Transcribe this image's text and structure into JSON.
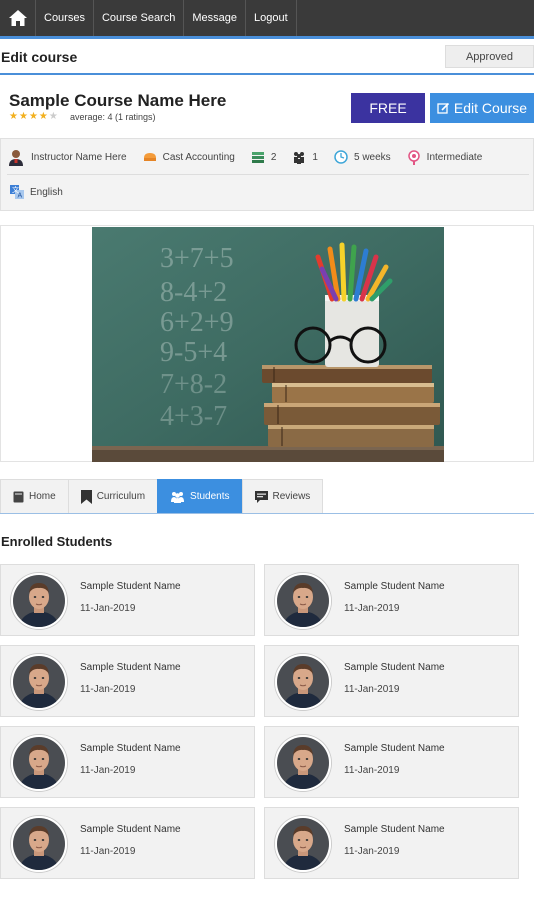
{
  "nav": {
    "items": [
      "Courses",
      "Course Search",
      "Message",
      "Logout"
    ]
  },
  "header": {
    "title": "Edit course",
    "status": "Approved"
  },
  "course": {
    "name": "Sample Course Name Here",
    "rating": 4,
    "rating_text": "average: 4 (1 ratings)",
    "price_label": "FREE",
    "edit_label": "Edit Course",
    "instructor": "Instructor Name Here",
    "category": "Cast Accounting",
    "lessons": "2",
    "students": "1",
    "duration": "5 weeks",
    "level": "Intermediate",
    "language": "English"
  },
  "tabs": [
    {
      "label": "Home"
    },
    {
      "label": "Curriculum"
    },
    {
      "label": "Students",
      "active": true
    },
    {
      "label": "Reviews"
    }
  ],
  "enrolled": {
    "title": "Enrolled Students",
    "students": [
      {
        "name": "Sample Student Name",
        "date": "11-Jan-2019"
      },
      {
        "name": "Sample Student Name",
        "date": "11-Jan-2019"
      },
      {
        "name": "Sample Student Name",
        "date": "11-Jan-2019"
      },
      {
        "name": "Sample Student Name",
        "date": "11-Jan-2019"
      },
      {
        "name": "Sample Student Name",
        "date": "11-Jan-2019"
      },
      {
        "name": "Sample Student Name",
        "date": "11-Jan-2019"
      },
      {
        "name": "Sample Student Name",
        "date": "11-Jan-2019"
      },
      {
        "name": "Sample Student Name",
        "date": "11-Jan-2019"
      }
    ]
  },
  "colors": {
    "nav_bg": "#3a3a3a",
    "accent": "#3c8fe0",
    "free_button": "#3b33a0",
    "star": "#f2b01e"
  },
  "icons": [
    "home-icon",
    "instructor-icon",
    "category-icon",
    "lessons-icon",
    "students-icon",
    "clock-icon",
    "level-icon",
    "language-icon",
    "book-icon",
    "bookmark-icon",
    "users-icon",
    "comments-icon",
    "edit-icon"
  ]
}
